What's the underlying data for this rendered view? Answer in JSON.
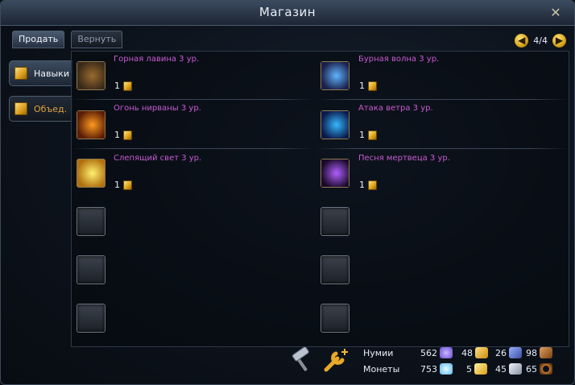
{
  "window": {
    "title": "Магазин",
    "close_glyph": "✕"
  },
  "tabs": [
    {
      "label": "Продать",
      "active": true
    },
    {
      "label": "Вернуть",
      "active": false
    }
  ],
  "pager": {
    "text": "4/4",
    "prev_glyph": "◀",
    "next_glyph": "▶"
  },
  "categories": [
    {
      "label": "Навыки",
      "active": true,
      "icon": "gift-box-icon"
    },
    {
      "label": "Объед.",
      "active": false,
      "icon": "gift-box-icon"
    }
  ],
  "items": [
    {
      "name": "Горная лавина 3 ур.",
      "price": "1",
      "icon": "mountain-avalanche-skill-icon",
      "colors": [
        "#3a2a18",
        "#9a6a30"
      ]
    },
    {
      "name": "Бурная волна 3 ур.",
      "price": "1",
      "icon": "storm-wave-skill-icon",
      "colors": [
        "#1b1f4a",
        "#5fb4ff"
      ]
    },
    {
      "name": "Огонь нирваны 3 ур.",
      "price": "1",
      "icon": "nirvana-fire-skill-icon",
      "colors": [
        "#5a1d05",
        "#ff9a20"
      ]
    },
    {
      "name": "Атака ветра 3 ур.",
      "price": "1",
      "icon": "wind-attack-skill-icon",
      "colors": [
        "#0b1a4a",
        "#35b8ff"
      ]
    },
    {
      "name": "Слепящий свет 3 ур.",
      "price": "1",
      "icon": "blinding-light-skill-icon",
      "colors": [
        "#b07010",
        "#fff070"
      ]
    },
    {
      "name": "Песня мертвеца 3 ур.",
      "price": "1",
      "icon": "dead-song-skill-icon",
      "colors": [
        "#1a0a2a",
        "#b060ff"
      ]
    }
  ],
  "bottom": {
    "tools": [
      {
        "name": "hammer-icon",
        "glyph": "🔨"
      },
      {
        "name": "wrench-plus-icon",
        "glyph": "🔧"
      }
    ],
    "currency_labels": [
      "Нумии",
      "Монеты"
    ],
    "currencies_row1": [
      {
        "value": "562",
        "icon": "numia-gem-icon",
        "color": "#7a6ad8"
      },
      {
        "value": "48",
        "icon": "gold-bag-icon",
        "color": "#d8a020"
      },
      {
        "value": "26",
        "icon": "blue-chest-icon",
        "color": "#5a7ad0"
      },
      {
        "value": "98",
        "icon": "bronze-chest-icon",
        "color": "#b07030"
      }
    ],
    "currencies_row2": [
      {
        "value": "753",
        "icon": "blue-diamond-icon",
        "color": "#7ad8ff"
      },
      {
        "value": "5",
        "icon": "gold-gift-icon",
        "color": "#e0b030"
      },
      {
        "value": "45",
        "icon": "silver-coins-icon",
        "color": "#b0b8c8"
      },
      {
        "value": "65",
        "icon": "bronze-ring-icon",
        "color": "#b06a28"
      }
    ]
  }
}
